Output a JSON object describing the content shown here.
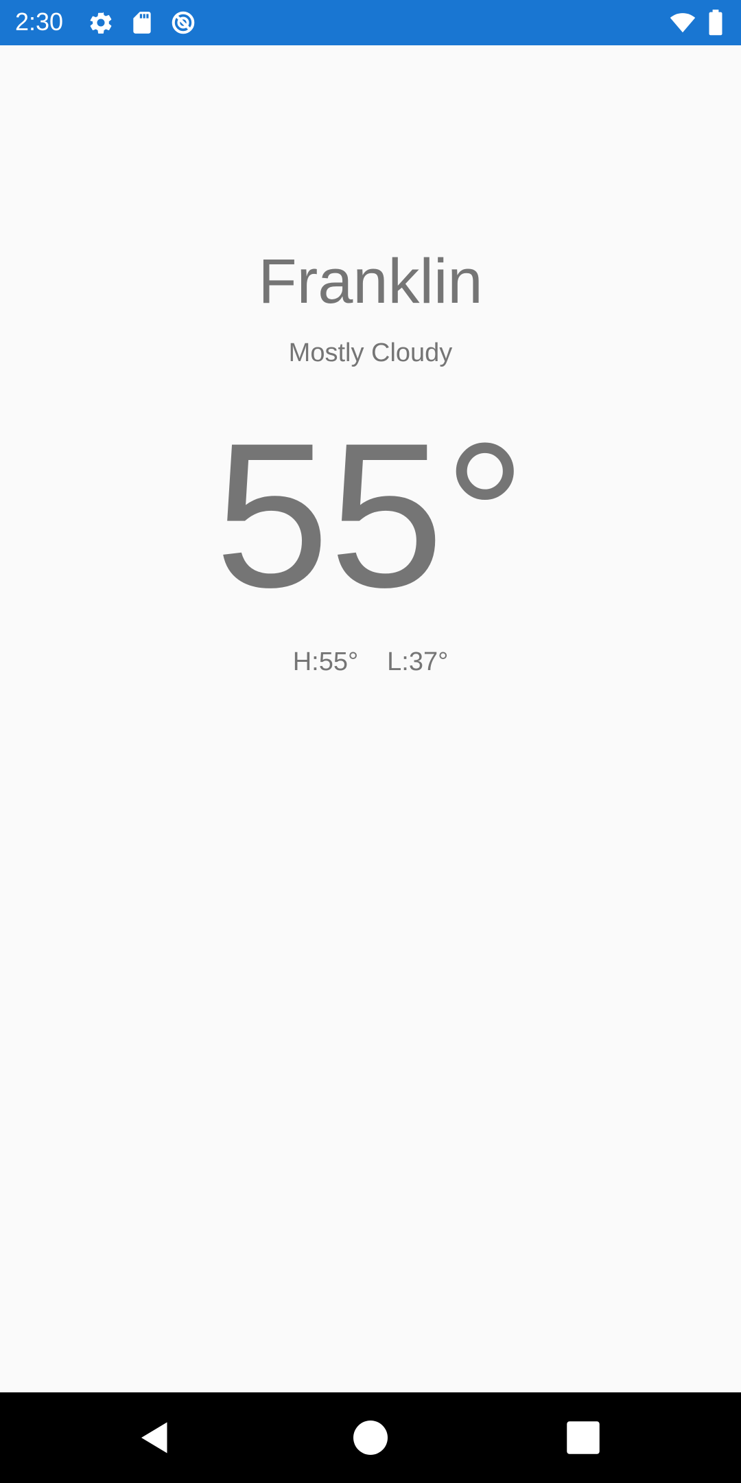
{
  "status_bar": {
    "time": "2:30",
    "icons": [
      "gear-icon",
      "sd-card-icon",
      "sync-icon",
      "wifi-icon",
      "battery-icon"
    ],
    "background_color": "#1976d2"
  },
  "weather": {
    "city": "Franklin",
    "condition": "Mostly Cloudy",
    "temperature": "55°",
    "high": "H:55°",
    "low": "L:37°",
    "text_color": "#757575"
  },
  "nav_bar": {
    "buttons": [
      "back-icon",
      "home-icon",
      "recents-icon"
    ]
  }
}
